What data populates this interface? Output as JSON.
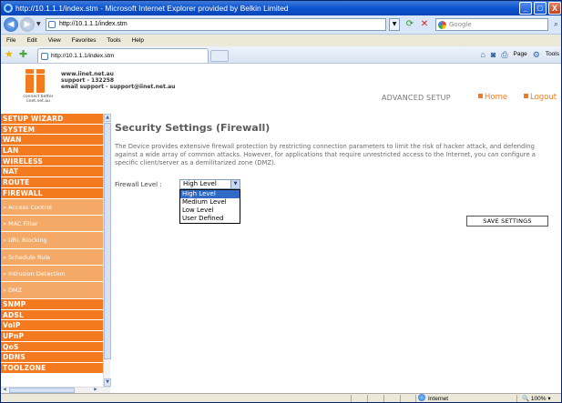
{
  "window": {
    "title": "http://10.1.1.1/index.stm - Microsoft Internet Explorer provided by Belkin Limited",
    "min": "_",
    "max": "□",
    "close": "X"
  },
  "addressbar": {
    "url": "http://10.1.1.1/index.stm",
    "search_placeholder": "Google"
  },
  "menu": [
    "File",
    "Edit",
    "View",
    "Favorites",
    "Tools",
    "Help"
  ],
  "tabs": {
    "active_title": "http://10.1.1.1/index.stm"
  },
  "commandbar": {
    "page": "Page",
    "tools": "Tools"
  },
  "router_header": {
    "tagline_1": "connect better",
    "tagline_2": "iinet.net.au",
    "website": "www.iinet.net.au",
    "support": "support - 132258",
    "email": "email support - support@iinet.net.au",
    "advanced_setup": "ADVANCED SETUP",
    "home": "Home",
    "logout": "Logout"
  },
  "sidebar": {
    "items": [
      {
        "label": "SETUP WIZARD",
        "type": "main"
      },
      {
        "label": "SYSTEM",
        "type": "main"
      },
      {
        "label": "WAN",
        "type": "main"
      },
      {
        "label": "LAN",
        "type": "main"
      },
      {
        "label": "WIRELESS",
        "type": "main"
      },
      {
        "label": "NAT",
        "type": "main"
      },
      {
        "label": "ROUTE",
        "type": "main"
      },
      {
        "label": "FIREWALL",
        "type": "main"
      },
      {
        "label": "» Access Control",
        "type": "sub"
      },
      {
        "label": "» MAC Filter",
        "type": "sub"
      },
      {
        "label": "» URL Blocking",
        "type": "sub"
      },
      {
        "label": "» Schedule Rule",
        "type": "sub"
      },
      {
        "label": "» Intrusion Detection",
        "type": "sub"
      },
      {
        "label": "» DMZ",
        "type": "sub"
      },
      {
        "label": "SNMP",
        "type": "main"
      },
      {
        "label": "ADSL",
        "type": "main"
      },
      {
        "label": "VoIP",
        "type": "main"
      },
      {
        "label": "UPnP",
        "type": "main"
      },
      {
        "label": "QoS",
        "type": "main"
      },
      {
        "label": "DDNS",
        "type": "main"
      },
      {
        "label": "TOOLZONE",
        "type": "main"
      }
    ]
  },
  "main": {
    "title": "Security Settings (Firewall)",
    "description": "The Device provides extensive firewall protection by restricting connection parameters to limit the risk of hacker attack, and defending against a wide array of common attacks. However, for applications that require unrestricted access to the Internet, you can configure a specific client/server as a demilitarized zone (DMZ).",
    "firewall_label": "Firewall Level :",
    "firewall_value": "High Level",
    "firewall_options": [
      "High Level",
      "Medium Level",
      "Low Level",
      "User Defined"
    ],
    "save_button": "SAVE SETTINGS"
  },
  "statusbar": {
    "zone": "Internet",
    "zoom": "100%"
  },
  "colors": {
    "accent": "#f47a20",
    "sub_item": "#f4a967",
    "selection": "#316ac5"
  }
}
